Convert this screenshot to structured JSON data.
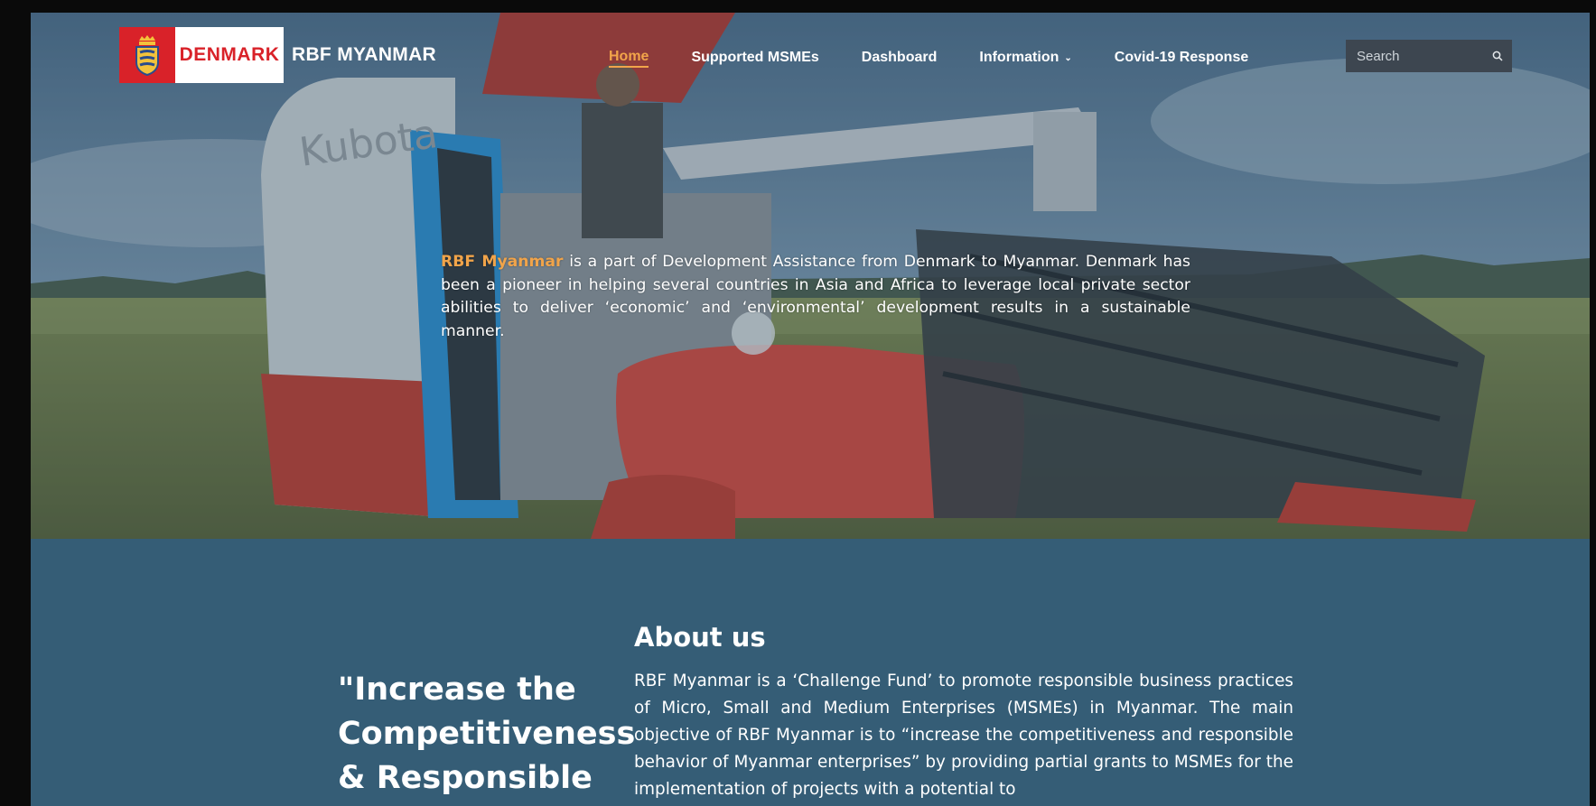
{
  "brand": {
    "logo_text": "DENMARK",
    "site_name": "RBF MYANMAR"
  },
  "nav": {
    "items": [
      {
        "label": "Home",
        "active": true
      },
      {
        "label": "Supported MSMEs"
      },
      {
        "label": "Dashboard"
      },
      {
        "label": "Information",
        "has_dropdown": true,
        "icon": "chevron-down-icon"
      },
      {
        "label": "Covid-19 Response"
      }
    ]
  },
  "search": {
    "placeholder": "Search",
    "icon": "search-icon"
  },
  "hero": {
    "highlight": "RBF Myanmar",
    "text": " is a part of Development Assistance from Denmark to Myanmar. Denmark has been a pioneer in helping several countries in Asia and Africa to leverage local private sector abilities to deliver ‘economic’ and ‘environmental’ development results in a sustainable manner."
  },
  "about": {
    "quote": "\"Increase the Competitiveness & Responsible",
    "title": "About us",
    "body": "RBF Myanmar is a ‘Challenge Fund’ to promote responsible business practices of Micro, Small and Medium Enterprises (MSMEs) in Myanmar. The main objective of RBF Myanmar is to “increase the competitiveness and responsible behavior of Myanmar enterprises” by providing partial grants to MSMEs for the implementation of projects with a potential to"
  },
  "colors": {
    "accent": "#f1a44a",
    "section_bg": "#355d76",
    "logo_red": "#d92229"
  }
}
